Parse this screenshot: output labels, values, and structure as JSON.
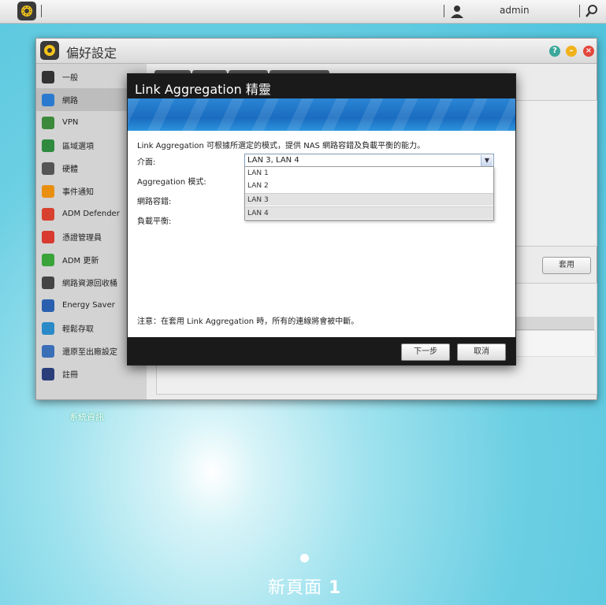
{
  "topbar": {
    "username": "admin"
  },
  "desktop": {
    "icon_label": "系統資訊",
    "page_name": "新頁面",
    "page_number": "1"
  },
  "window": {
    "title": "偏好設定",
    "sidebar": [
      {
        "label": "一般",
        "icon": "general-icon",
        "color": "#333333"
      },
      {
        "label": "網路",
        "icon": "network-globe-icon",
        "color": "#2a7bd0",
        "active": true
      },
      {
        "label": "VPN",
        "icon": "vpn-icon",
        "color": "#3b8a3b"
      },
      {
        "label": "區域選項",
        "icon": "region-globe-icon",
        "color": "#2f8a3f"
      },
      {
        "label": "硬體",
        "icon": "hardware-wrench-icon",
        "color": "#555555"
      },
      {
        "label": "事件通知",
        "icon": "alert-icon",
        "color": "#e88f10"
      },
      {
        "label": "ADM Defender",
        "icon": "firewall-icon",
        "color": "#d8412f"
      },
      {
        "label": "憑證管理員",
        "icon": "certificate-icon",
        "color": "#d83a2f"
      },
      {
        "label": "ADM 更新",
        "icon": "update-arrow-icon",
        "color": "#3aa33a"
      },
      {
        "label": "網路資源回收桶",
        "icon": "recycle-bin-icon",
        "color": "#444444"
      },
      {
        "label": "Energy Saver",
        "icon": "energy-icon",
        "color": "#2a5fb0"
      },
      {
        "label": "輕鬆存取",
        "icon": "cloud-access-icon",
        "color": "#2a8ac8"
      },
      {
        "label": "還原至出廠設定",
        "icon": "restore-icon",
        "color": "#3a6fb8"
      },
      {
        "label": "註冊",
        "icon": "register-icon",
        "color": "#2a3f7a"
      }
    ],
    "apply_label": "套用"
  },
  "wizard": {
    "title": "Link Aggregation 精靈",
    "description": "Link Aggregation 可根據所選定的模式，提供 NAS 網路容錯及負載平衡的能力。",
    "fields": {
      "interface_label": "介面:",
      "mode_label": "Aggregation 模式:",
      "fault_tolerance_label": "網路容錯:",
      "load_balance_label": "負載平衡:"
    },
    "interface_value": "LAN 3, LAN 4",
    "interface_options": [
      "LAN 1",
      "LAN 2",
      "LAN 3",
      "LAN 4"
    ],
    "note": "注意：在套用 Link Aggregation 時，所有的連線將會被中斷。",
    "next_label": "下一步",
    "cancel_label": "取消"
  },
  "colors": {
    "accent_blue": "#1a6cc0",
    "dialog_dark": "#1a1a1a"
  }
}
